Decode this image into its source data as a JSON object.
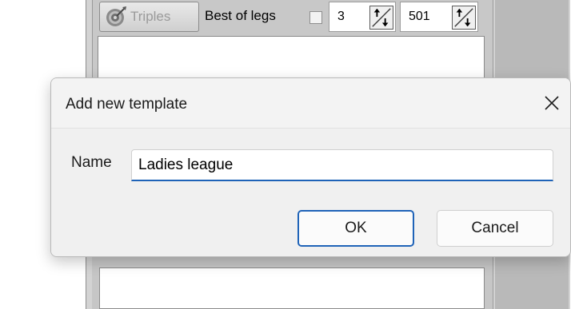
{
  "background_app": {
    "toolbar": {
      "triples_label": "Triples",
      "best_of_label": "Best of legs",
      "legs_value": "3",
      "score_value": "501"
    }
  },
  "dialog": {
    "title": "Add new template",
    "name_label": "Name",
    "name_value": "Ladies league",
    "ok_label": "OK",
    "cancel_label": "Cancel"
  },
  "colors": {
    "accent": "#1f63b8",
    "dialog_bg": "#f3f3f3",
    "app_bg": "#d3d3d3"
  },
  "icons": {
    "triples": "dartboard-icon",
    "close": "close-icon",
    "spinner": "spinner-arrows-icon"
  }
}
